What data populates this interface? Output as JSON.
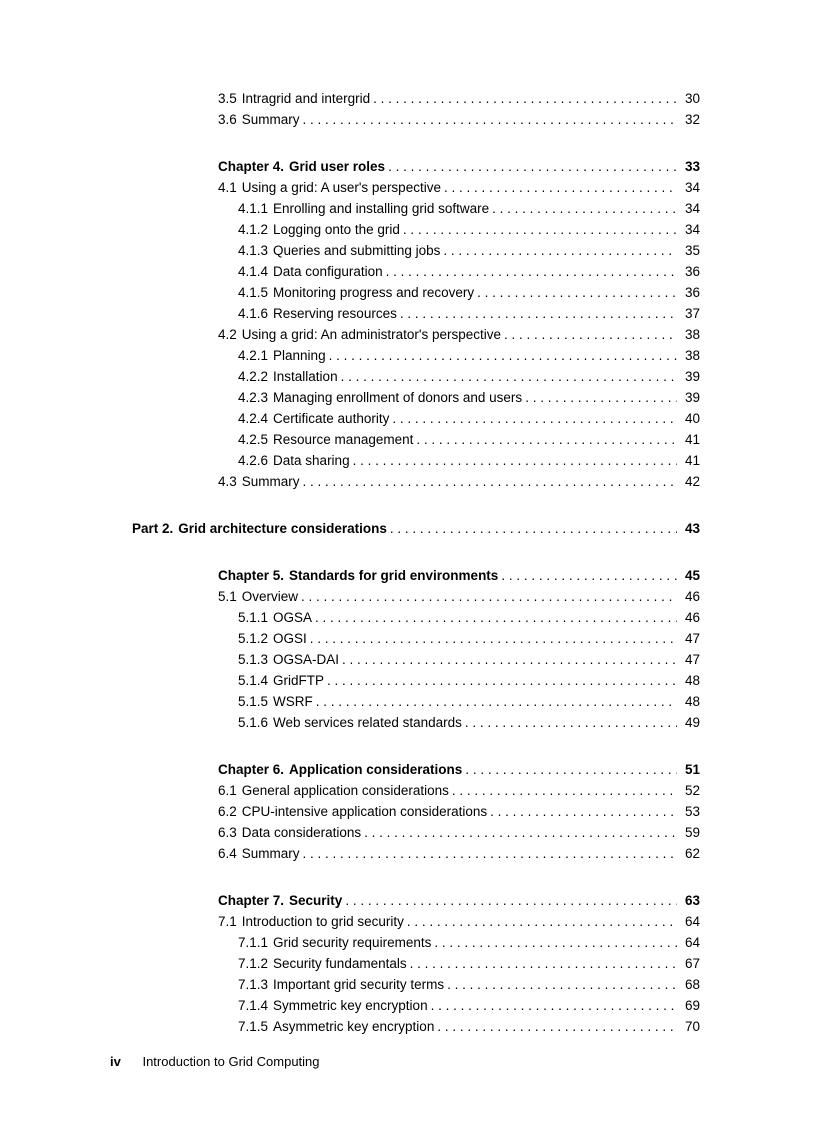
{
  "footer": {
    "page_number": "iv",
    "title": "Introduction to Grid Computing"
  },
  "blocks": [
    {
      "entries": [
        {
          "level": 1,
          "num": "3.5",
          "title": "Intragrid and intergrid",
          "page": "30"
        },
        {
          "level": 1,
          "num": "3.6",
          "title": "Summary",
          "page": "32"
        }
      ]
    },
    {
      "entries": [
        {
          "level": 1,
          "chapter": true,
          "num": "Chapter 4.",
          "title": "Grid user roles",
          "page": "33"
        },
        {
          "level": 1,
          "num": "4.1",
          "title": "Using a grid: A user's perspective",
          "page": "34"
        },
        {
          "level": 2,
          "num": "4.1.1",
          "title": "Enrolling and installing grid software",
          "page": "34"
        },
        {
          "level": 2,
          "num": "4.1.2",
          "title": "Logging onto the grid",
          "page": "34"
        },
        {
          "level": 2,
          "num": "4.1.3",
          "title": "Queries and submitting jobs",
          "page": "35"
        },
        {
          "level": 2,
          "num": "4.1.4",
          "title": "Data configuration",
          "page": "36"
        },
        {
          "level": 2,
          "num": "4.1.5",
          "title": "Monitoring progress and recovery",
          "page": "36"
        },
        {
          "level": 2,
          "num": "4.1.6",
          "title": "Reserving resources",
          "page": "37"
        },
        {
          "level": 1,
          "num": "4.2",
          "title": "Using a grid: An administrator's perspective",
          "page": "38"
        },
        {
          "level": 2,
          "num": "4.2.1",
          "title": "Planning",
          "page": "38"
        },
        {
          "level": 2,
          "num": "4.2.2",
          "title": "Installation",
          "page": "39"
        },
        {
          "level": 2,
          "num": "4.2.3",
          "title": "Managing enrollment of donors and users",
          "page": "39"
        },
        {
          "level": 2,
          "num": "4.2.4",
          "title": "Certificate authority",
          "page": "40"
        },
        {
          "level": 2,
          "num": "4.2.5",
          "title": "Resource management",
          "page": "41"
        },
        {
          "level": 2,
          "num": "4.2.6",
          "title": "Data sharing",
          "page": "41"
        },
        {
          "level": 1,
          "num": "4.3",
          "title": "Summary",
          "page": "42"
        }
      ]
    },
    {
      "entries": [
        {
          "level": 0,
          "part": true,
          "num": "Part 2.",
          "title": "Grid architecture considerations",
          "page": "43"
        }
      ]
    },
    {
      "entries": [
        {
          "level": 1,
          "chapter": true,
          "num": "Chapter 5.",
          "title": "Standards for grid environments",
          "page": "45"
        },
        {
          "level": 1,
          "num": "5.1",
          "title": "Overview",
          "page": "46"
        },
        {
          "level": 2,
          "num": "5.1.1",
          "title": "OGSA",
          "page": "46"
        },
        {
          "level": 2,
          "num": "5.1.2",
          "title": "OGSI",
          "page": "47"
        },
        {
          "level": 2,
          "num": "5.1.3",
          "title": "OGSA-DAI",
          "page": "47"
        },
        {
          "level": 2,
          "num": "5.1.4",
          "title": "GridFTP",
          "page": "48"
        },
        {
          "level": 2,
          "num": "5.1.5",
          "title": "WSRF",
          "page": "48"
        },
        {
          "level": 2,
          "num": "5.1.6",
          "title": "Web services related standards",
          "page": "49"
        }
      ]
    },
    {
      "entries": [
        {
          "level": 1,
          "chapter": true,
          "num": "Chapter 6.",
          "title": "Application considerations",
          "page": "51"
        },
        {
          "level": 1,
          "num": "6.1",
          "title": "General application considerations",
          "page": "52"
        },
        {
          "level": 1,
          "num": "6.2",
          "title": "CPU-intensive application considerations",
          "page": "53"
        },
        {
          "level": 1,
          "num": "6.3",
          "title": "Data considerations",
          "page": "59"
        },
        {
          "level": 1,
          "num": "6.4",
          "title": "Summary",
          "page": "62"
        }
      ]
    },
    {
      "entries": [
        {
          "level": 1,
          "chapter": true,
          "num": "Chapter 7.",
          "title": "Security",
          "page": "63"
        },
        {
          "level": 1,
          "num": "7.1",
          "title": "Introduction to grid security",
          "page": "64"
        },
        {
          "level": 2,
          "num": "7.1.1",
          "title": "Grid security requirements",
          "page": "64"
        },
        {
          "level": 2,
          "num": "7.1.2",
          "title": "Security fundamentals",
          "page": "67"
        },
        {
          "level": 2,
          "num": "7.1.3",
          "title": "Important grid security terms",
          "page": "68"
        },
        {
          "level": 2,
          "num": "7.1.4",
          "title": "Symmetric key encryption",
          "page": "69"
        },
        {
          "level": 2,
          "num": "7.1.5",
          "title": "Asymmetric key encryption",
          "page": "70"
        }
      ]
    }
  ]
}
